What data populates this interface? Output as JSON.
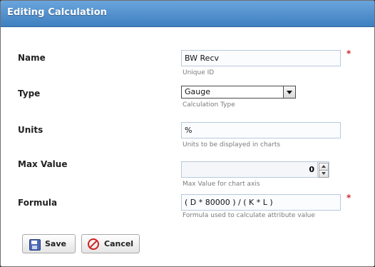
{
  "dialog": {
    "title": "Editing Calculation"
  },
  "fields": {
    "name": {
      "label": "Name",
      "value": "BW Recv",
      "hint": "Unique ID",
      "required_marker": "*"
    },
    "type": {
      "label": "Type",
      "value": "Gauge",
      "hint": "Calculation Type"
    },
    "units": {
      "label": "Units",
      "value": "%",
      "hint": "Units to be displayed in charts"
    },
    "max_value": {
      "label": "Max Value",
      "value": "0",
      "hint": "Max Value for chart axis"
    },
    "formula": {
      "label": "Formula",
      "value": "( D * 80000 ) / ( K * L )",
      "hint": "Formula used to calculate attribute value",
      "required_marker": "*"
    }
  },
  "buttons": {
    "save": "Save",
    "cancel": "Cancel"
  },
  "colors": {
    "titlebar": "#4f8fcf",
    "hint": "#7b7b7b",
    "required": "#cc2a2a"
  },
  "icons": {
    "save": "floppy-disk-icon",
    "cancel": "cancel-icon",
    "dropdown": "chevron-down-icon",
    "spinner_up": "arrow-up-icon",
    "spinner_down": "arrow-down-icon"
  }
}
